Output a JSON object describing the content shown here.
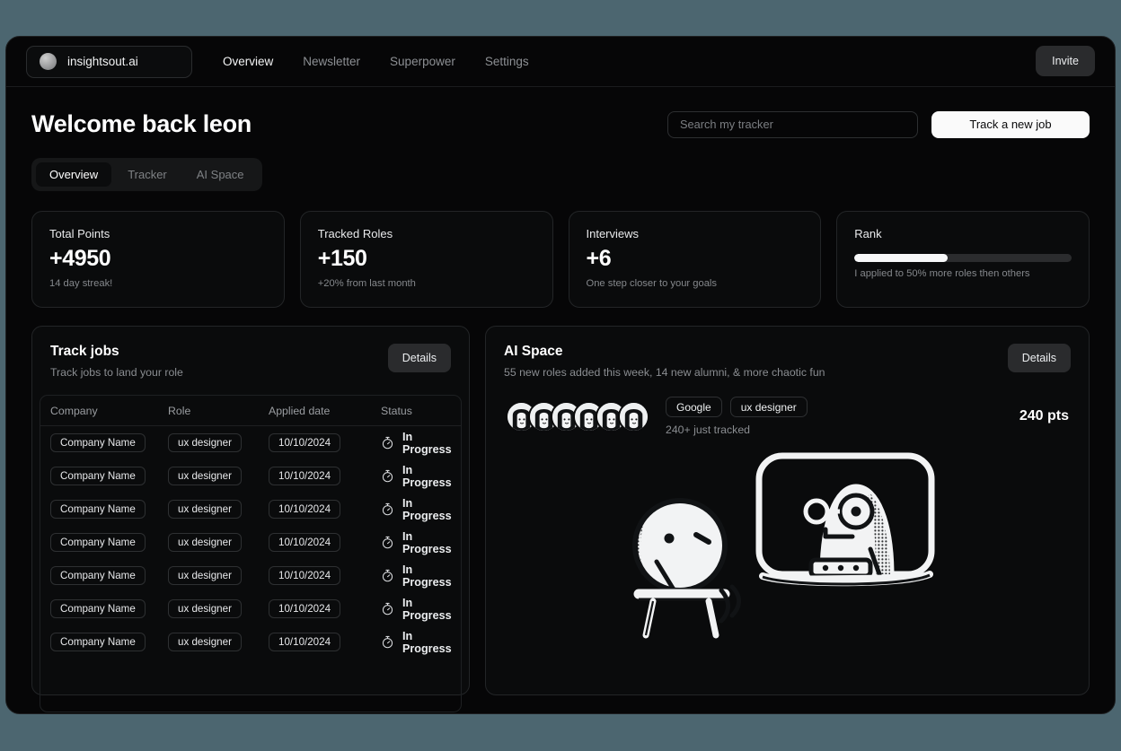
{
  "nav": {
    "brand_name": "insightsout.ai",
    "links": [
      {
        "label": "Overview",
        "active": true
      },
      {
        "label": "Newsletter",
        "active": false
      },
      {
        "label": "Superpower",
        "active": false
      },
      {
        "label": "Settings",
        "active": false
      }
    ],
    "invite_label": "Invite"
  },
  "header": {
    "welcome": "Welcome back leon",
    "search_placeholder": "Search my tracker",
    "search_value": "",
    "track_button": "Track a new job"
  },
  "tabs": [
    {
      "label": "Overview",
      "active": true
    },
    {
      "label": "Tracker",
      "active": false
    },
    {
      "label": "AI Space",
      "active": false
    }
  ],
  "stats": [
    {
      "title": "Total Points",
      "value": "+4950",
      "sub": "14 day streak!"
    },
    {
      "title": "Tracked Roles",
      "value": "+150",
      "sub": "+20% from last month"
    },
    {
      "title": "Interviews",
      "value": "+6",
      "sub": "One step closer to your goals"
    },
    {
      "title": "Rank",
      "value": "",
      "sub": "I applied to 50% more roles then others",
      "progress_percent": 43
    }
  ],
  "track_jobs": {
    "title": "Track jobs",
    "subtitle": "Track jobs to land your role",
    "details_label": "Details",
    "columns": [
      "Company",
      "Role",
      "Applied date",
      "Status"
    ],
    "rows": [
      {
        "company": "Company Name",
        "role": "ux designer",
        "applied": "10/10/2024",
        "status": "In Progress",
        "status_icon": "stopwatch-icon"
      },
      {
        "company": "Company Name",
        "role": "ux designer",
        "applied": "10/10/2024",
        "status": "In Progress",
        "status_icon": "stopwatch-icon"
      },
      {
        "company": "Company Name",
        "role": "ux designer",
        "applied": "10/10/2024",
        "status": "In Progress",
        "status_icon": "stopwatch-icon"
      },
      {
        "company": "Company Name",
        "role": "ux designer",
        "applied": "10/10/2024",
        "status": "In Progress",
        "status_icon": "stopwatch-icon"
      },
      {
        "company": "Company Name",
        "role": "ux designer",
        "applied": "10/10/2024",
        "status": "In Progress",
        "status_icon": "stopwatch-icon"
      },
      {
        "company": "Company Name",
        "role": "ux designer",
        "applied": "10/10/2024",
        "status": "In Progress",
        "status_icon": "stopwatch-icon"
      },
      {
        "company": "Company Name",
        "role": "ux designer",
        "applied": "10/10/2024",
        "status": "In Progress",
        "status_icon": "stopwatch-icon"
      }
    ]
  },
  "ai_space": {
    "title": "AI Space",
    "subtitle": "55 new roles added this week, 14 new alumni, & more chaotic fun",
    "details_label": "Details",
    "avatar_count": 6,
    "tags": [
      "Google",
      "ux designer"
    ],
    "tracked_label": "240+ just tracked",
    "points_label": "240 pts",
    "illustration_name": "person-at-desk-with-screen-illustration"
  },
  "colors": {
    "backdrop": "#4c6670",
    "window_bg": "#060607",
    "card_bg": "#0a0b0c",
    "card_border": "#232527",
    "accent_white": "#fafafa",
    "muted_text": "#8a8d91"
  }
}
